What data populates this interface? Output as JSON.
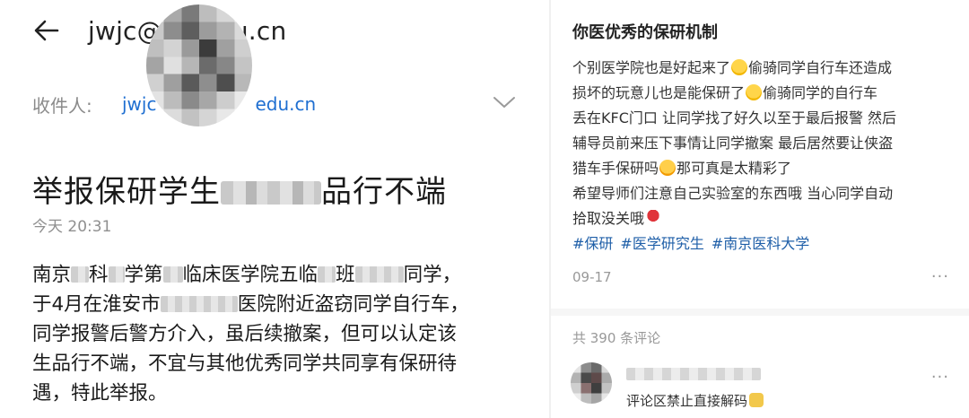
{
  "email": {
    "sender_prefix": "jwjc@",
    "sender_suffix": "du.cn",
    "recipient_label": "收件人:",
    "recipient_prefix": "jwjc",
    "recipient_suffix": "edu.cn",
    "subject_prefix": "举报保研学生",
    "subject_suffix": "品行不端",
    "time": "今天 20:31",
    "body": {
      "line1": [
        "南京",
        "科",
        "学第",
        "临床医学院五临",
        "班",
        "同学，"
      ],
      "line2": [
        "于4月在淮安市",
        "医院附近盗窃同学自行车，"
      ],
      "line3": "同学报警后警方介入，虽后续撤案，但可以认定该",
      "line4": "生品行不端，不宜与其他优秀同学共同享有保研待",
      "line5": "遇，特此举报。"
    }
  },
  "post": {
    "title": "你医优秀的保研机制",
    "lines": {
      "l1a": "个别医学院也是好起来了",
      "l1b": "偷骑同学自行车还造成",
      "l2a": "损坏的玩意儿也是能保研了",
      "l2b": "偷骑同学的自行车",
      "l3": "丢在KFC门口 让同学找了好久以至于最后报警 然后",
      "l4": "辅导员前来压下事情让同学撤案 最后居然要让侠盗",
      "l5a": "猎车手保研吗",
      "l5b": "那可真是太精彩了",
      "l6": "希望导师们注意自己实验室的东西哦 当心同学自动",
      "l7": "拾取没关哦"
    },
    "hashtags": [
      "#保研",
      "#医学研究生",
      "#南京医科大学"
    ],
    "date": "09-17",
    "more": "···",
    "comment_count": "共 390 条评论",
    "comment_text": "评论区禁止直接解码",
    "comment_more": "···"
  },
  "icons": {
    "back": "back-arrow-icon",
    "chevron": "chevron-down-icon",
    "emoji_cry": "crying-face-emoji",
    "emoji_love": "heart-eyes-emoji",
    "emoji_rose": "rose-emoji",
    "emoji_pray": "praying-hands-emoji"
  },
  "colors": {
    "link": "#1f6fd1",
    "hashtag": "#1f5fa8",
    "muted": "#8f8f8f"
  }
}
